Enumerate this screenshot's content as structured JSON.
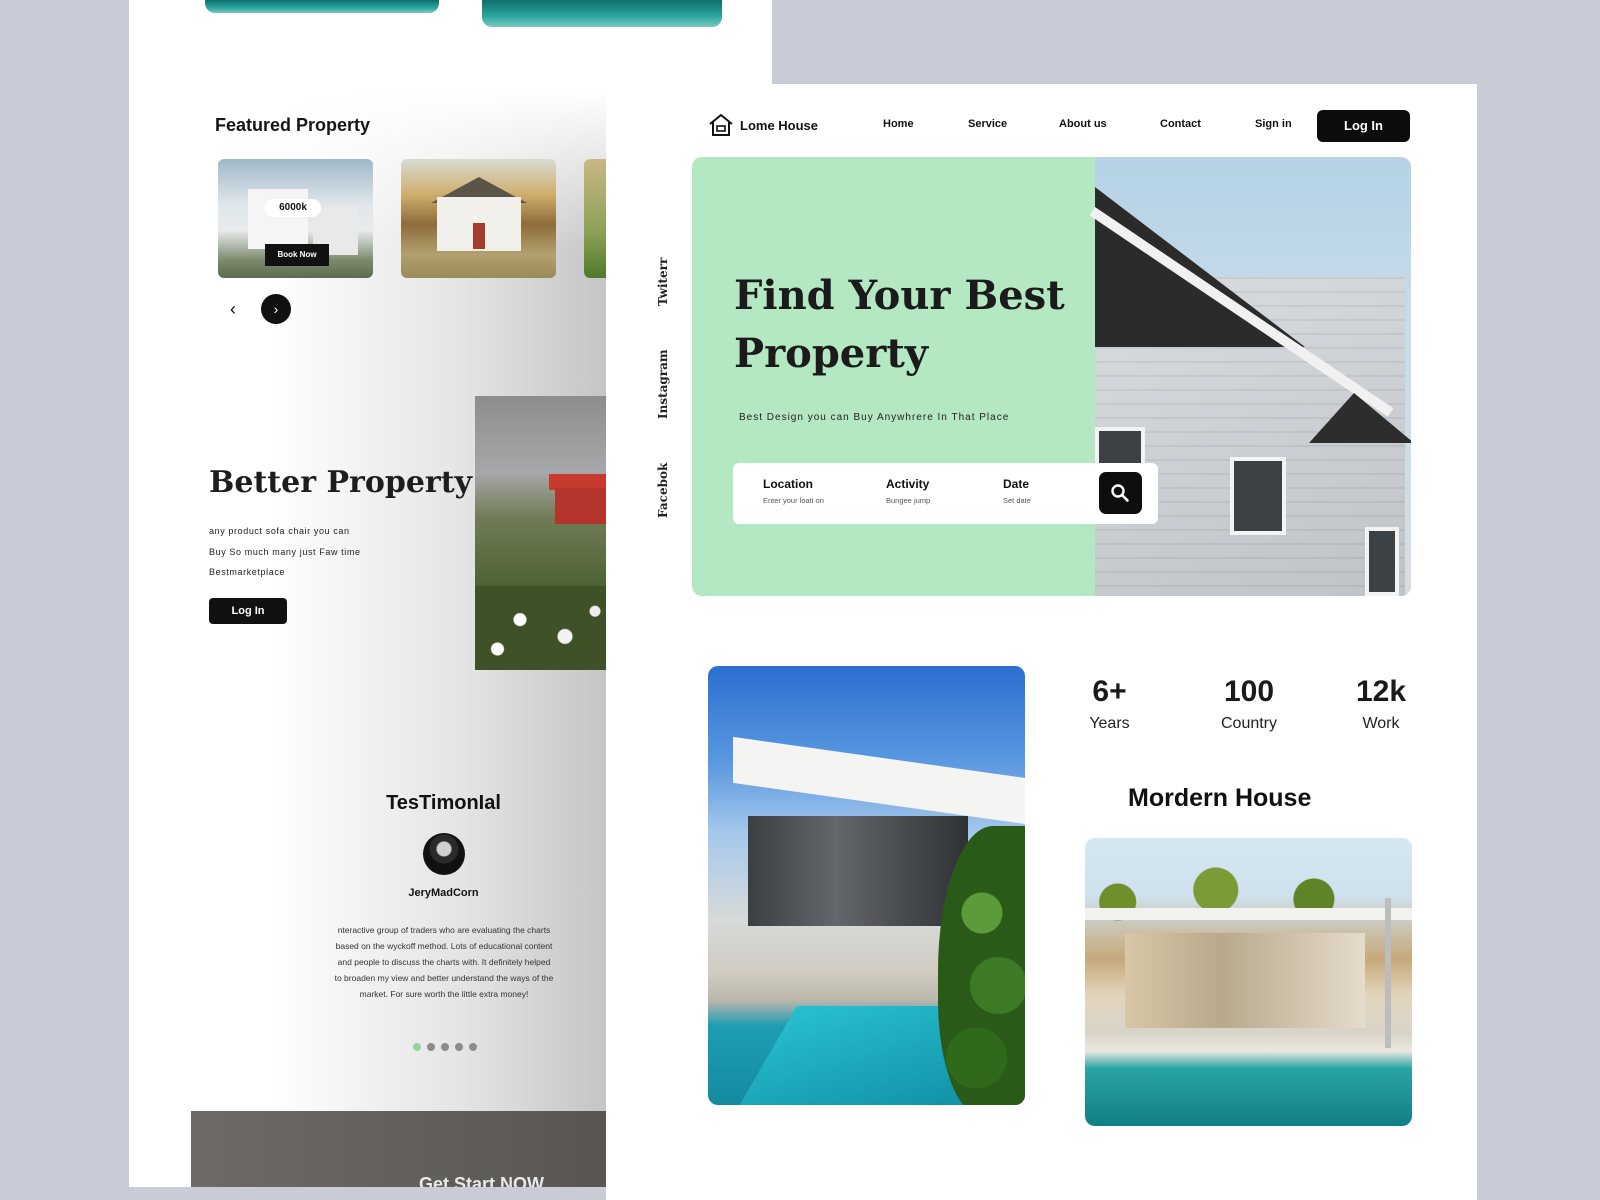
{
  "back": {
    "featured_title": "Featured Property",
    "cards": [
      {
        "price": "6000k",
        "book_label": "Book Now"
      },
      {},
      {}
    ],
    "arrows": {
      "prev": "‹",
      "next": "›"
    },
    "better": {
      "title": "Better Property",
      "lines": [
        "any product  sofa chair   you can",
        "Buy  So much many just Faw time",
        "Bestmarketplace"
      ],
      "login_label": "Log In"
    },
    "testimonial": {
      "title": "TesTimonIal",
      "name": "JeryMadCorn",
      "text": "nteractive group of traders who are evaluating the charts based on the wyckoff method. Lots of educational content and people to discuss the charts with. It definitely helped to broaden my view and better understand the ways of the market. For sure worth the little extra money!",
      "dots": 5,
      "active_dot": 0
    },
    "cta_label": "Get Start NOW"
  },
  "front": {
    "brand": "Lome House",
    "nav": [
      "Home",
      "Service",
      "About us",
      "Contact",
      "Sign in"
    ],
    "login_label": "Log In",
    "social": [
      "Twiterr",
      "Instagram",
      "Facebok"
    ],
    "hero": {
      "title": "Find Your Best Property",
      "subtitle": "Best Design   you can Buy Anywhrere In That Place",
      "search": {
        "location_label": "Location",
        "location_placeholder": "Enter your loati on",
        "activity_label": "Activity",
        "activity_placeholder": "Bungee jump",
        "date_label": "Date",
        "date_placeholder": "Set date"
      }
    },
    "stats": [
      {
        "value": "6+",
        "label": "Years"
      },
      {
        "value": "100",
        "label": "Country"
      },
      {
        "value": "12k",
        "label": "Work"
      }
    ],
    "modern_title": "Mordern House"
  },
  "icons": {
    "logo": "house-outline-icon",
    "search": "magnifier-icon",
    "prev": "chevron-left-icon",
    "next": "chevron-right-icon"
  },
  "colors": {
    "background": "#c9ccd6",
    "hero_green": "#b4e8c2",
    "dark": "#0d0d0d",
    "active_dot": "#8fd59e"
  }
}
